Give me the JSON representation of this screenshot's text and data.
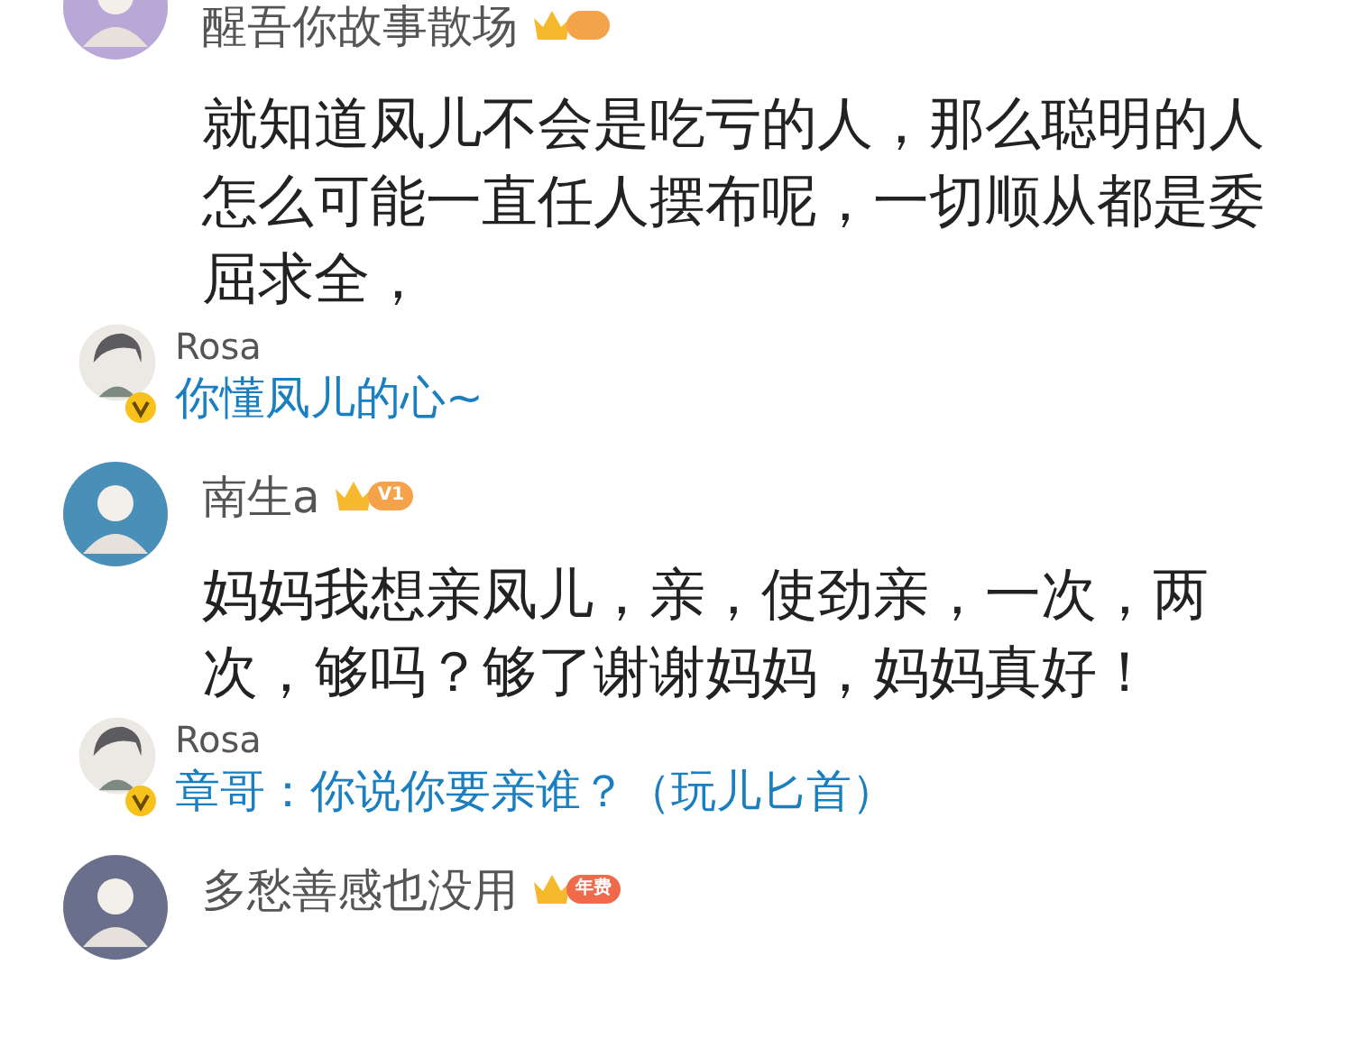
{
  "comments": [
    {
      "user": "醒吾你故事散场",
      "badge": {
        "kind": "level"
      },
      "text": "就知道凤儿不会是吃亏的人，那么聪明的人怎么可能一直任人摆布呢，一切顺从都是委屈求全，",
      "reply": {
        "user": "Rosa",
        "verified": true,
        "text": "你懂凤儿的心~"
      }
    },
    {
      "user": "南生a",
      "badge": {
        "kind": "level",
        "label": "V1"
      },
      "text": "妈妈我想亲凤儿，亲，使劲亲，一次，两次，够吗？够了谢谢妈妈，妈妈真好！",
      "reply": {
        "user": "Rosa",
        "verified": true,
        "text": "章哥：你说你要亲谁？（玩儿匕首）"
      }
    },
    {
      "user": "多愁善感也没用",
      "badge": {
        "kind": "annual",
        "label": "年费"
      }
    }
  ]
}
